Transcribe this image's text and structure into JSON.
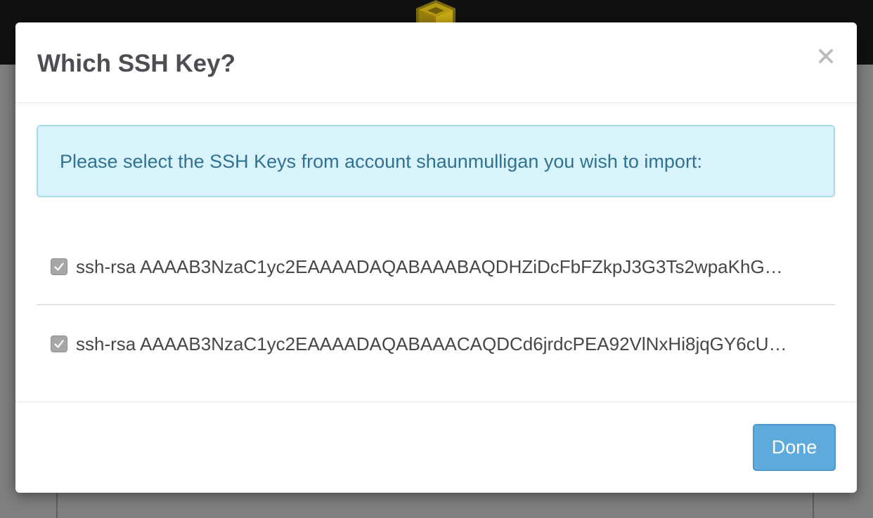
{
  "modal": {
    "title": "Which SSH Key?",
    "close_label": "×"
  },
  "alert": {
    "message": "Please select the SSH Keys from account shaunmulligan you wish to import:"
  },
  "keys": [
    {
      "label": "ssh-rsa AAAAB3NzaC1yc2EAAAADAQABAAABAQDHZiDcFbFZkpJ3G3Ts2wpaKhG…",
      "checked": true
    },
    {
      "label": "ssh-rsa AAAAB3NzaC1yc2EAAAADAQABAAACAQDCd6jrdcPEA92VlNxHi8jqGY6cU…",
      "checked": true
    }
  ],
  "footer": {
    "done_label": "Done"
  },
  "icons": {
    "logo": "cube-logo-icon",
    "close": "close-icon",
    "check": "checkmark-icon"
  },
  "colors": {
    "primary_button": "#5faadd",
    "alert_background": "#d9f3fb",
    "alert_text": "#2f7293",
    "overlay": "#7f7f7f",
    "topbar": "#111111"
  }
}
